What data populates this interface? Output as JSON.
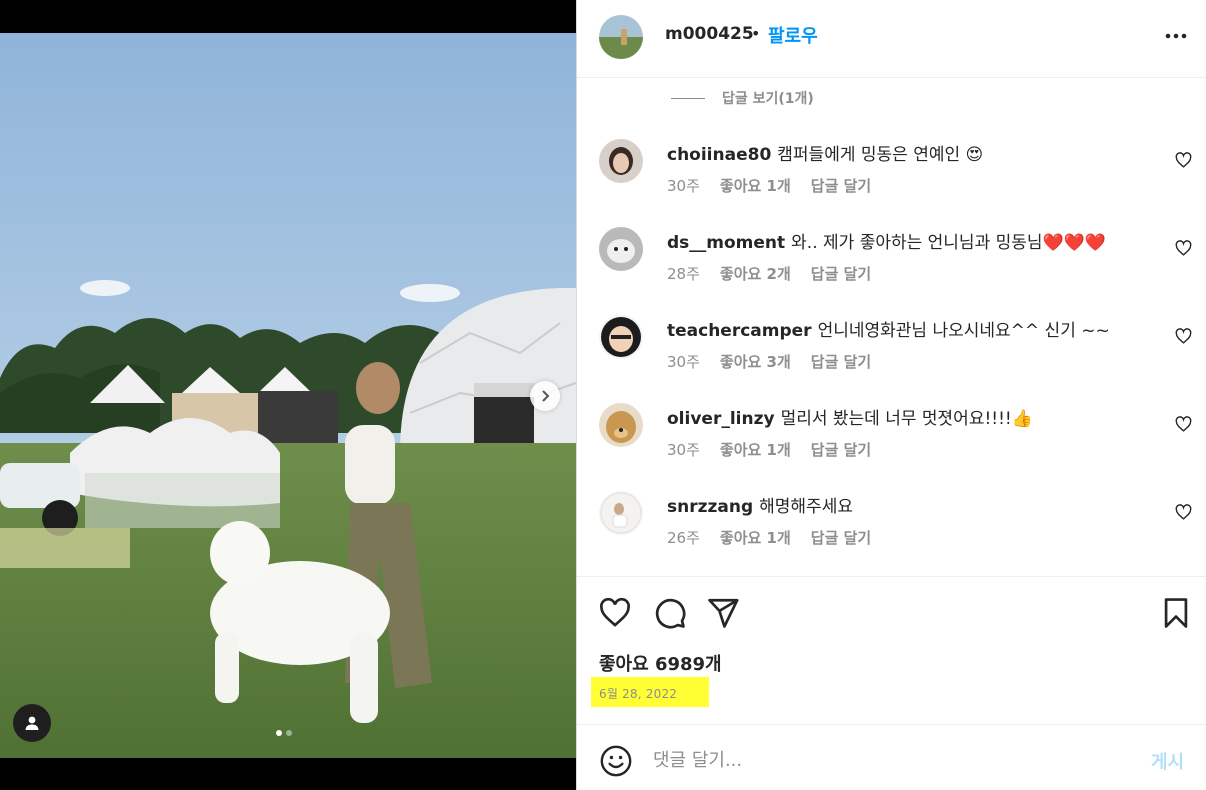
{
  "post": {
    "username": "m000425",
    "separator": "•",
    "follow_label": "팔로우",
    "more_icon": "more-horizontal-icon"
  },
  "replies": {
    "label": "답글 보기(1개)"
  },
  "comments": [
    {
      "user": "choiinae80",
      "text": "캠퍼들에게 밍동은 연예인 😍",
      "time": "30주",
      "likes": "좋아요 1개",
      "reply": "답글 달기"
    },
    {
      "user": "ds__moment",
      "text": "와.. 제가 좋아하는 언니님과 밍동님❤️❤️❤️",
      "time": "28주",
      "likes": "좋아요 2개",
      "reply": "답글 달기"
    },
    {
      "user": "teachercamper",
      "text": "언니네영화관님 나오시네요^^ 신기 ~~",
      "time": "30주",
      "likes": "좋아요 3개",
      "reply": "답글 달기"
    },
    {
      "user": "oliver_linzy",
      "text": "멀리서 봤는데 너무 멋졋어요!!!!👍",
      "time": "30주",
      "likes": "좋아요 1개",
      "reply": "답글 달기"
    },
    {
      "user": "snrzzang",
      "text": "해명해주세요",
      "time": "26주",
      "likes": "좋아요 1개",
      "reply": "답글 달기"
    }
  ],
  "actions": {
    "likes_label": "좋아요 6989개",
    "date": "6월 28, 2022"
  },
  "composer": {
    "placeholder": "댓글 달기...",
    "post_label": "게시"
  },
  "colors": {
    "accent": "#0095f6",
    "muted": "#8e8e8e",
    "highlight": "#ffff33",
    "post_disabled": "#b2dffc"
  }
}
